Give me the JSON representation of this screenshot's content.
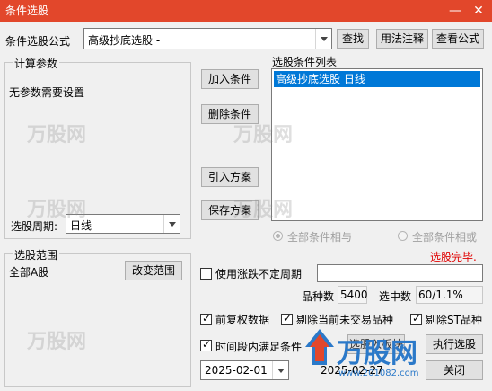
{
  "window": {
    "title": "条件选股",
    "minimize": "—",
    "close": "✕"
  },
  "top": {
    "formula_label": "条件选股公式",
    "formula_value": "高级抄底选股  -",
    "btn_find": "查找",
    "btn_usage": "用法注释",
    "btn_view": "查看公式"
  },
  "params": {
    "group_title": "计算参数",
    "none_text": "无参数需要设置",
    "period_label": "选股周期:",
    "period_value": "日线"
  },
  "actions": {
    "add": "加入条件",
    "remove": "删除条件",
    "import": "引入方案",
    "save": "保存方案"
  },
  "conditions": {
    "list_title": "选股条件列表",
    "items": [
      "高级抄底选股  日线"
    ],
    "radio_and": "全部条件相与",
    "radio_or": "全部条件相或",
    "status": "选股完毕."
  },
  "range": {
    "group_title": "选股范围",
    "value": "全部A股",
    "change_btn": "改变范围"
  },
  "options": {
    "irregular_label": "使用涨跌不定周期",
    "count_label": "品种数",
    "count_value": "5400",
    "selected_label": "选中数",
    "selected_value": "60/1.1%",
    "adjust_label": "前复权数据",
    "exclude_untraded_label": "剔除当前未交易品种",
    "exclude_st_label": "剔除ST品种",
    "period_satisfy_label": "时间段内满足条件",
    "start_date": "2025-02-01",
    "end_date": "2025-02-27"
  },
  "bottom": {
    "btn_to_block": "选股入板块",
    "btn_run": "执行选股",
    "btn_close": "关闭"
  },
  "watermark": {
    "text": "万股网",
    "brand": "万股网",
    "url": "www.201082.com"
  }
}
